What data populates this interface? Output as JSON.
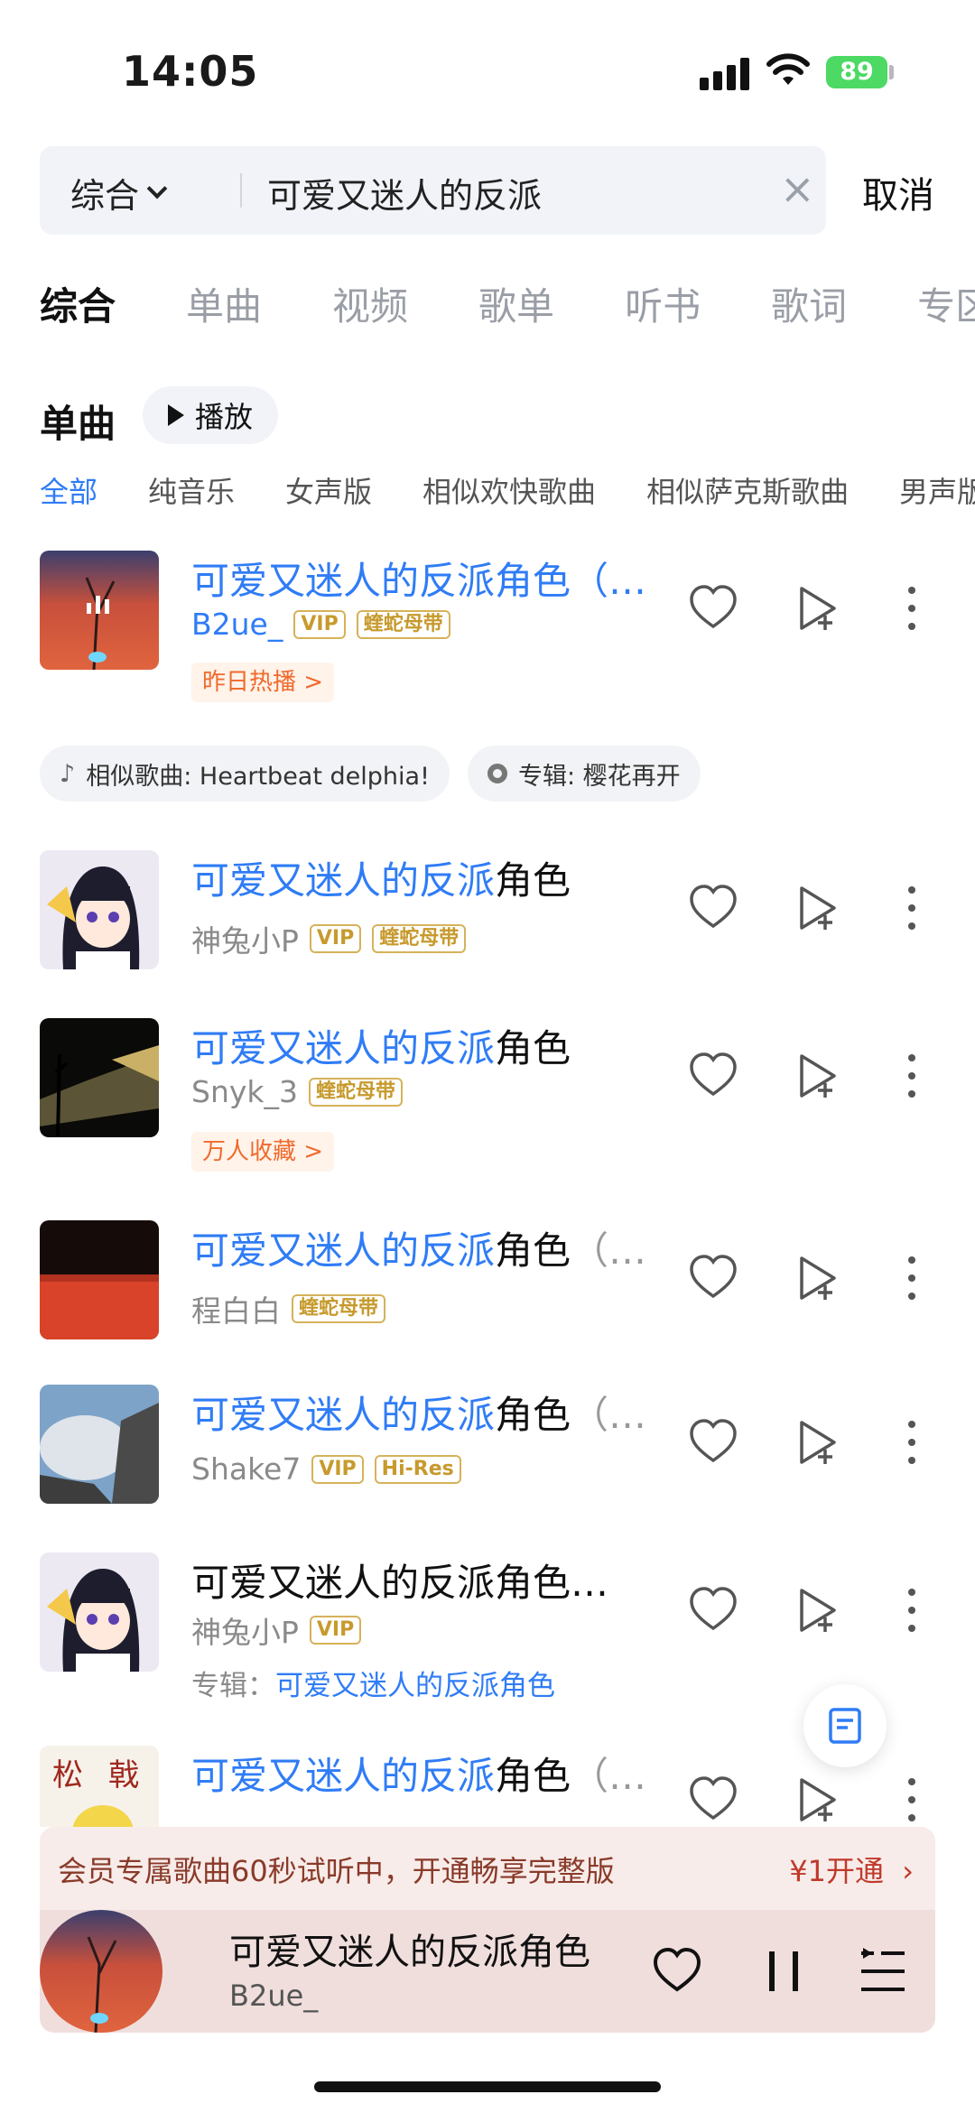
{
  "status_bar": {
    "time": "14:05",
    "battery": "89"
  },
  "search": {
    "scope": "综合",
    "query": "可爱又迷人的反派",
    "cancel": "取消"
  },
  "tabs": [
    "综合",
    "单曲",
    "视频",
    "歌单",
    "听书",
    "歌词",
    "专区"
  ],
  "section": {
    "title": "单曲",
    "play_all": "播放"
  },
  "filters": [
    "全部",
    "纯音乐",
    "女声版",
    "相似欢快歌曲",
    "相似萨克斯歌曲",
    "男声版"
  ],
  "songs": [
    {
      "title_hl": "可爱又迷人的反派角色（",
      "title_rest": "",
      "title_tail": "…",
      "artist": "B2ue_",
      "badges": [
        "VIP",
        "蝰蛇母带"
      ],
      "tag": "昨日热播 >"
    },
    {
      "title_hl": "可爱又迷人的反派",
      "title_rest": "角色",
      "title_tail": "",
      "artist": "神兔小P",
      "badges": [
        "VIP",
        "蝰蛇母带"
      ],
      "tag": ""
    },
    {
      "title_hl": "可爱又迷人的反派",
      "title_rest": "角色",
      "title_tail": "",
      "artist": "Snyk_3",
      "badges": [
        "蝰蛇母带"
      ],
      "tag": "万人收藏 >"
    },
    {
      "title_hl": "可爱又迷人的反派",
      "title_rest": "角色",
      "title_tail": "（…",
      "artist": "程白白",
      "badges": [
        "蝰蛇母带"
      ],
      "tag": ""
    },
    {
      "title_hl": "可爱又迷人的反派",
      "title_rest": "角色",
      "title_tail": "（…",
      "artist": "Shake7",
      "badges": [
        "VIP",
        "Hi-Res"
      ],
      "tag": ""
    },
    {
      "title_hl": "",
      "title_rest": "可爱又迷人的反派角色…",
      "title_tail": "",
      "artist": "神兔小P",
      "badges": [
        "VIP"
      ],
      "album_label": "专辑：",
      "album_hl": "可爱又迷人的反派",
      "album_rest": "角色"
    },
    {
      "title_hl": "可爱又迷人的反派",
      "title_rest": "角色",
      "title_tail": "（…",
      "artist": "",
      "badges": [],
      "tag": ""
    }
  ],
  "related_chips": [
    {
      "icon": "music-note-icon",
      "label": "相似歌曲: Heartbeat delphia!"
    },
    {
      "icon": "disc-icon",
      "label": "专辑: 樱花再开"
    }
  ],
  "vip_banner": {
    "text": "会员专属歌曲60秒试听中，开通畅享完整版",
    "cta": "¥1开通"
  },
  "player": {
    "title": "可爱又迷人的反派角色",
    "artist": "B2ue_"
  },
  "colors": {
    "accent": "#2f7cf6",
    "vip_gold": "#c79a2d",
    "tag_orange": "#f06a2c",
    "battery_green": "#4cd964"
  }
}
